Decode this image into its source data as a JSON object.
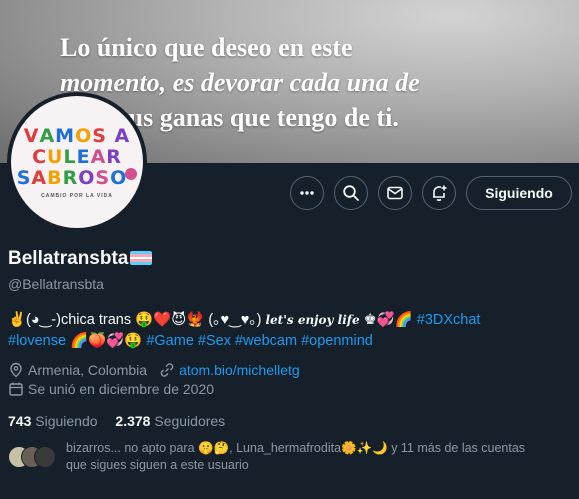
{
  "banner": {
    "line1": "Lo único que deseo en este",
    "line2": "momento, es devorar cada una de",
    "line3": "tus ganas que tengo de ti."
  },
  "avatar": {
    "line1": "VAMOS A",
    "line2": "CULEAR",
    "line3": "SABROSO",
    "tagline": "CAMBIO POR LA VIDA"
  },
  "actions": {
    "more_icon": "ellipsis-icon",
    "search_icon": "search-icon",
    "message_icon": "envelope-icon",
    "subscribe_icon": "bell-plus-icon",
    "follow_label": "Siguiendo"
  },
  "profile": {
    "display_name": "Bellatransbta",
    "flag_icon": "transgender-flag-icon",
    "handle": "@Bellatransbta",
    "bio_part1": "✌️(◕‿-)chica trans 🤑❤️😈🐦‍🔥 (｡♥‿♥｡) ",
    "bio_script": "let's enjoy life",
    "bio_part2": " ♚💞🌈",
    "hashtags_line1": [
      "#3DXchat"
    ],
    "hashtag_lovense": "#lovense",
    "bio_emoji_line2": " 🌈🍑💞🤑  ",
    "hashtags_line2": [
      "#Game",
      "#Sex",
      "#webcam",
      "#openmind"
    ],
    "location": "Armenia, Colombia",
    "link": "atom.bio/michelletg",
    "joined": "Se unió en diciembre de 2020"
  },
  "stats": {
    "following_count": "743",
    "following_label": "Siguiendo",
    "followers_count": "2.378",
    "followers_label": "Seguidores"
  },
  "known_followers": {
    "text_line1": "bizarros... no apto para 🤫🤔, Luna_hermafrodita🌼✨🌙 y 11 más de las cuentas",
    "text_line2": "que sigues siguen a este usuario"
  },
  "colors": {
    "background": "#15202b",
    "accent": "#1d9bf0",
    "muted": "#8b98a5"
  }
}
